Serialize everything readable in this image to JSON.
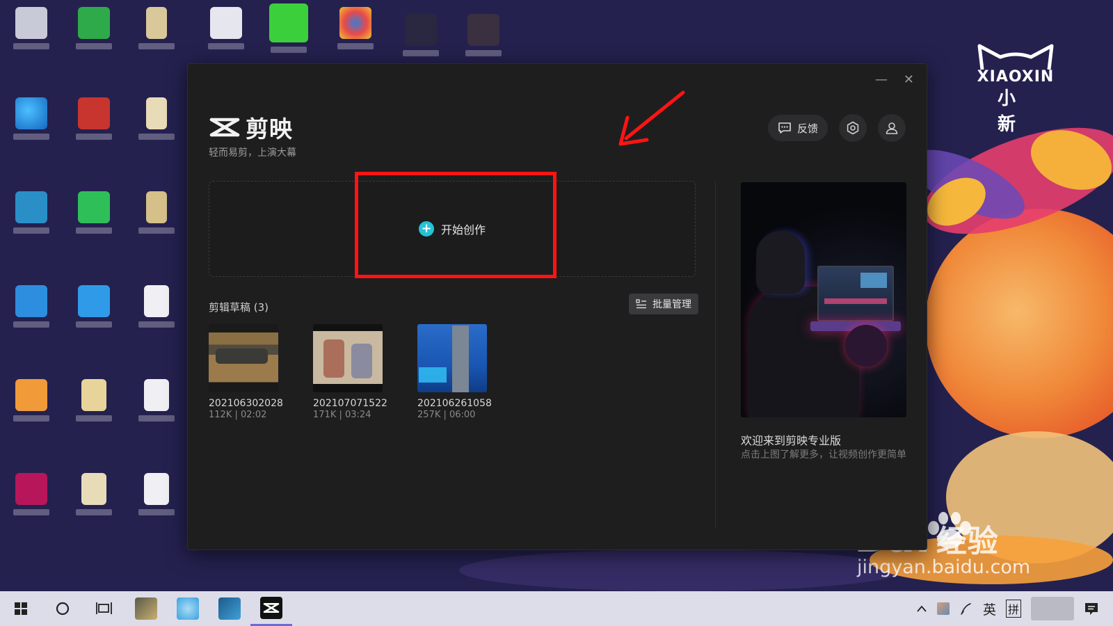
{
  "app": {
    "name": "剪映",
    "slogan": "轻而易剪，上演大幕",
    "feedback_label": "反馈",
    "create_label": "开始创作",
    "drafts_title": "剪辑草稿 (3)",
    "batch_label": "批量管理",
    "drafts": [
      {
        "name": "202106302028",
        "meta": "112K | 02:02"
      },
      {
        "name": "202107071522",
        "meta": "171K | 03:24"
      },
      {
        "name": "202106261058",
        "meta": "257K | 06:00"
      }
    ],
    "promo": {
      "title": "欢迎来到剪映专业版",
      "desc": "点击上图了解更多，让视频创作更简单"
    }
  },
  "desktop": {
    "brand_en": "XIAOXIN",
    "brand_cn": "小新",
    "watermark_main": "Bai",
    "watermark_cn": "经验",
    "watermark_sub": "jingyan.baidu.com"
  },
  "taskbar": {
    "ime_lang": "英",
    "ime_mode": "拼"
  },
  "colors": {
    "accent": "#22c4d6",
    "highlight": "#ff1414",
    "window_bg": "#1e1e1f"
  }
}
